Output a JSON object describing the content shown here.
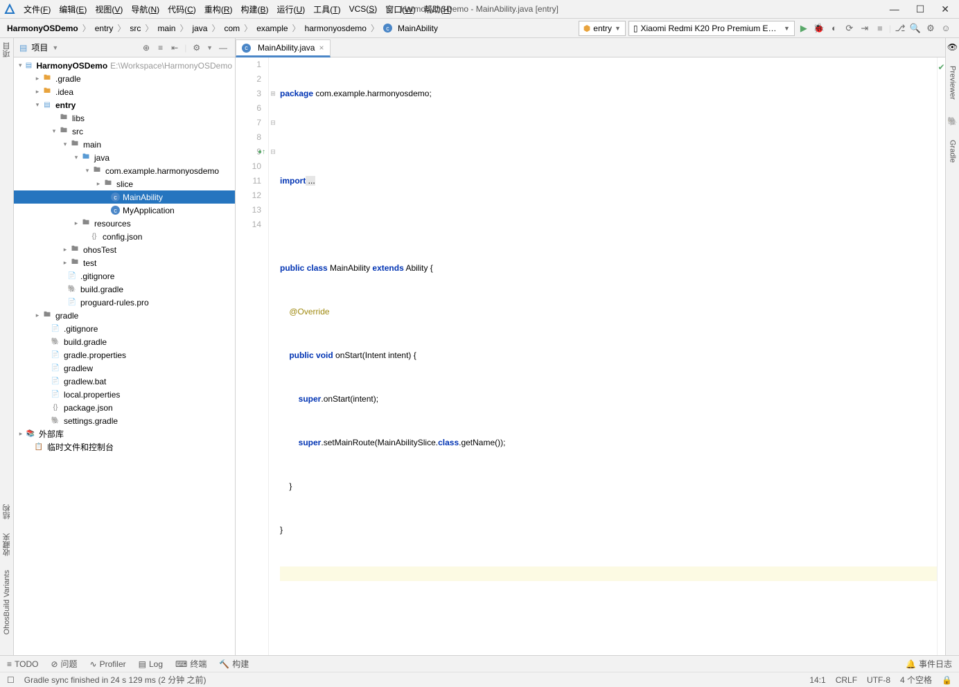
{
  "window": {
    "title": "HarmonyOSDemo - MainAbility.java [entry]"
  },
  "menu": {
    "file": "文件",
    "file_u": "F",
    "edit": "编辑",
    "edit_u": "E",
    "view": "视图",
    "view_u": "V",
    "nav": "导航",
    "nav_u": "N",
    "code": "代码",
    "code_u": "C",
    "refactor": "重构",
    "refactor_u": "R",
    "build": "构建",
    "build_u": "B",
    "run": "运行",
    "run_u": "U",
    "tools": "工具",
    "tools_u": "T",
    "vcs": "VCS",
    "vcs_u": "S",
    "window": "窗口",
    "window_u": "W",
    "help": "帮助",
    "help_u": "H"
  },
  "breadcrumb": [
    "HarmonyOSDemo",
    "entry",
    "src",
    "main",
    "java",
    "com",
    "example",
    "harmonyosdemo",
    "MainAbility"
  ],
  "runconfig": "entry",
  "device": "Xiaomi Redmi K20 Pro Premium Edition",
  "sidebar": {
    "title": "项目",
    "root": {
      "name": "HarmonyOSDemo",
      "path": "E:\\Workspace\\HarmonyOSDemo"
    },
    "items": {
      "gradle_dir": ".gradle",
      "idea_dir": ".idea",
      "entry": "entry",
      "libs": "libs",
      "src": "src",
      "main": "main",
      "java": "java",
      "pkg": "com.example.harmonyosdemo",
      "slice": "slice",
      "mainability": "MainAbility",
      "myapplication": "MyApplication",
      "resources": "resources",
      "configjson": "config.json",
      "ohostest": "ohosTest",
      "test": "test",
      "gitignore": ".gitignore",
      "buildgradle": "build.gradle",
      "proguard": "proguard-rules.pro",
      "gradle": "gradle",
      "gitignore2": ".gitignore",
      "buildgradle2": "build.gradle",
      "gradleprops": "gradle.properties",
      "gradlew": "gradlew",
      "gradlewbat": "gradlew.bat",
      "localprops": "local.properties",
      "packagejson": "package.json",
      "settingsgradle": "settings.gradle",
      "extlib": "外部库",
      "scratch": "临时文件和控制台"
    }
  },
  "tab": {
    "name": "MainAbility.java"
  },
  "code": {
    "lines": [
      "1",
      "2",
      "3",
      "6",
      "7",
      "8",
      "9",
      "10",
      "11",
      "12",
      "13",
      "14"
    ],
    "l1_kw": "package",
    "l1_rest": " com.example.harmonyosdemo;",
    "l3_kw": "import",
    "l3_rest": " ...",
    "l7_public": "public",
    "l7_class": "class",
    "l7_name": " MainAbility ",
    "l7_extends": "extends",
    "l7_sup": " Ability {",
    "l8": "@Override",
    "l9_public": "public",
    "l9_void": "void",
    "l9_sig": " onStart(Intent intent) {",
    "l10_super": "super",
    "l10_rest": ".onStart(intent);",
    "l11_super": "super",
    "l11_a": ".setMainRoute(MainAbilitySlice.",
    "l11_class": "class",
    "l11_b": ".getName());",
    "l12": "    }",
    "l13": "}"
  },
  "leftgutter": {
    "project": "项目",
    "structure": "结构",
    "favorites": "收藏夹",
    "variants": "OhosBuild Variants"
  },
  "rightgutter": {
    "previewer": "Previewer",
    "gradle": "Gradle"
  },
  "bottom": {
    "todo": "TODO",
    "problems": "问题",
    "profiler": "Profiler",
    "log": "Log",
    "terminal": "终端",
    "build": "构建",
    "eventlog": "事件日志"
  },
  "status": {
    "msg": "Gradle sync finished in 24 s 129 ms (2 分钟 之前)",
    "pos": "14:1",
    "le": "CRLF",
    "enc": "UTF-8",
    "indent": "4 个空格"
  }
}
